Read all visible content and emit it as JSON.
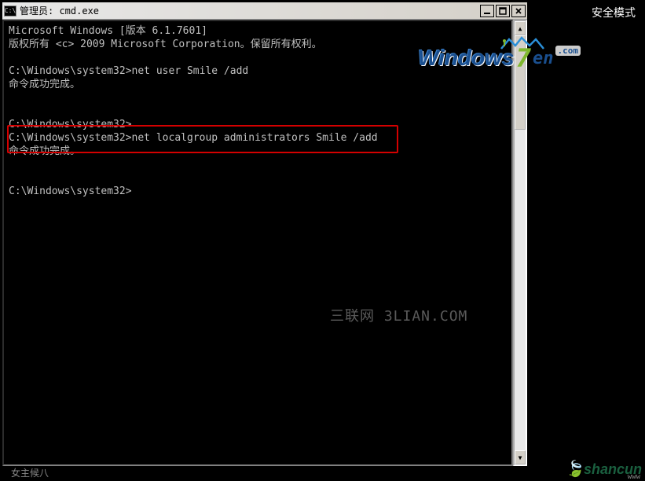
{
  "safe_mode_label": "安全模式",
  "window": {
    "icon_text": "C:\\",
    "title": "管理员: cmd.exe"
  },
  "console": {
    "line1": "Microsoft Windows [版本 6.1.7601]",
    "line2": "版权所有 <c> 2009 Microsoft Corporation。保留所有权利。",
    "blank": "",
    "prompt1": "C:\\Windows\\system32>net user Smile /add",
    "result1": "命令成功完成。",
    "prompt2": "C:\\Windows\\system32>",
    "prompt3": "C:\\Windows\\system32>net localgroup administrators Smile /add",
    "result3": "命令成功完成。",
    "prompt4": "C:\\Windows\\system32>"
  },
  "watermarks": {
    "center": "三联网 3LIAN.COM",
    "win7_windows": "Windows",
    "win7_seven": "7",
    "win7_en": "en",
    "win7_com": ".com",
    "shancun": "shancun",
    "shancun_sub": "www",
    "bottom": "女主候八"
  },
  "scrollbar": {
    "up": "▲",
    "down": "▼"
  },
  "winbuttons": {
    "min": "_",
    "max": "❐",
    "close": "✕"
  }
}
